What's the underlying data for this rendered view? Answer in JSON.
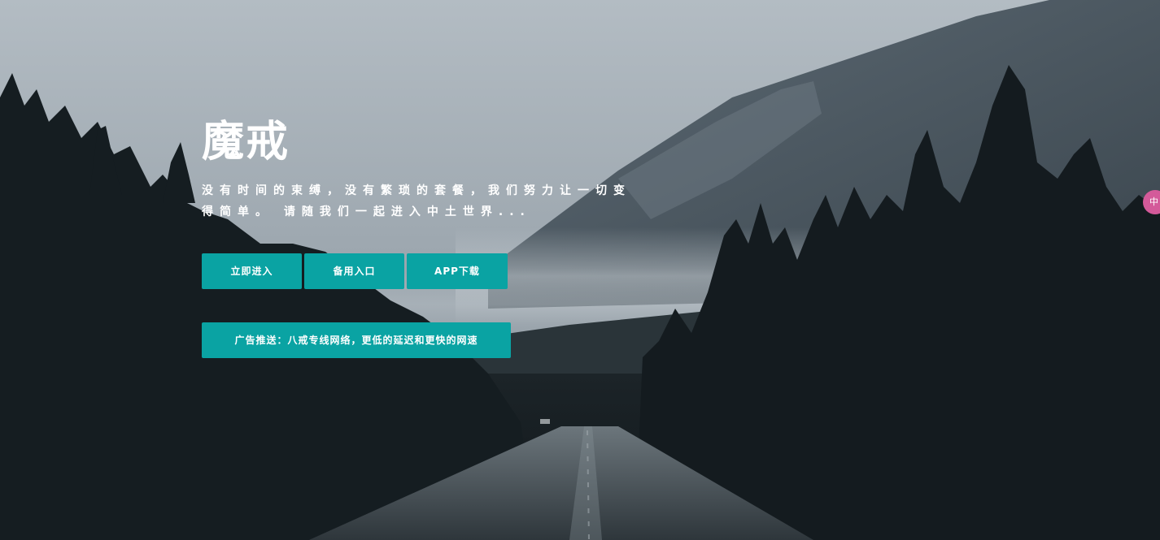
{
  "hero": {
    "title": "魔戒",
    "tagline": "没有时间的束缚，没有繁琐的套餐，我们努力让一切变得简单。 请随我们一起进入中土世界..."
  },
  "buttons": {
    "enter_label": "立即进入",
    "backup_label": "备用入口",
    "app_label": "APP下载",
    "ad_label": "广告推送：八戒专线网络，更低的延迟和更快的网速"
  },
  "side_tab": {
    "label": "中"
  },
  "colors": {
    "accent": "#0aa3a3",
    "side_tab": "#d45a9a"
  }
}
